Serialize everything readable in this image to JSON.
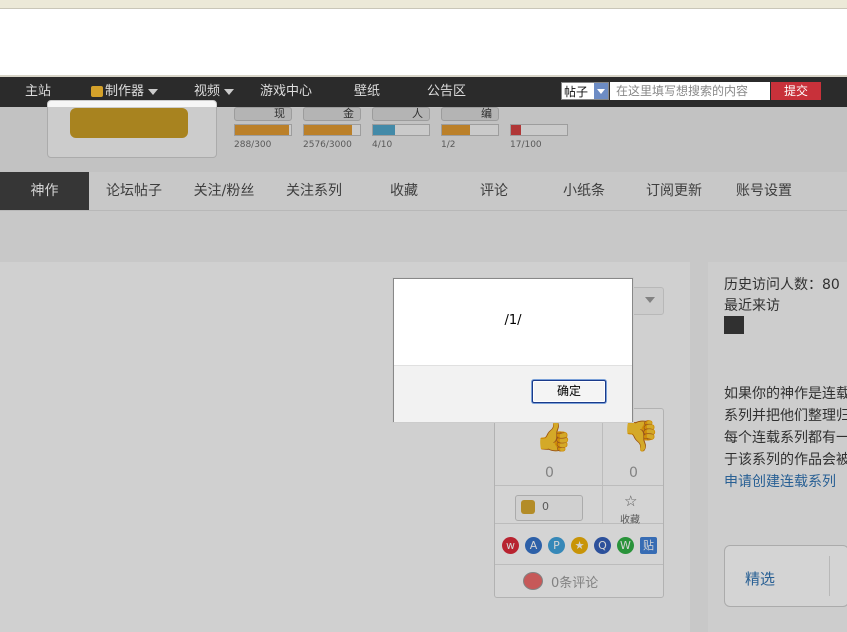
{
  "nav": {
    "items": [
      "主站",
      "制作器",
      "视频",
      "游戏中心",
      "壁纸",
      "公告区"
    ],
    "search_type": "帖子",
    "search_placeholder": "在这里填写想搜索的内容",
    "search_button": "提交"
  },
  "stats": [
    {
      "label": "现",
      "value": "288/300",
      "fraction": 0.96,
      "color": "#e0962a"
    },
    {
      "label": "金",
      "value": "2576/3000",
      "fraction": 0.86,
      "color": "#e0962a"
    },
    {
      "label": "人",
      "value": "4/10",
      "fraction": 0.4,
      "color": "#4aa3c9"
    },
    {
      "label": "编",
      "value": "1/2",
      "fraction": 0.5,
      "color": "#e0962a"
    },
    {
      "label": "",
      "value": "17/100",
      "fraction": 0.17,
      "color": "#d23b3b"
    }
  ],
  "tabs": [
    "神作",
    "论坛帖子",
    "关注/粉丝",
    "关注系列",
    "收藏",
    "评论",
    "小纸条",
    "订阅更新",
    "账号设置"
  ],
  "actions": {
    "like_count": "0",
    "dislike_count": "0",
    "coin_count": "0",
    "fav_label": "收藏",
    "comments": "0条评论"
  },
  "sidebar": {
    "visits_label": "历史访问人数：",
    "visits_value": "80",
    "recent_label": "最近来访",
    "series_text": [
      "如果你的神作是连载",
      "系列并把他们整理归",
      "每个连载系列都有一",
      "于该系列的作品会被"
    ],
    "apply_link": "申请创建连载系列",
    "featured_label": "精选"
  },
  "dialog": {
    "message": "/1/",
    "ok": "确定"
  }
}
